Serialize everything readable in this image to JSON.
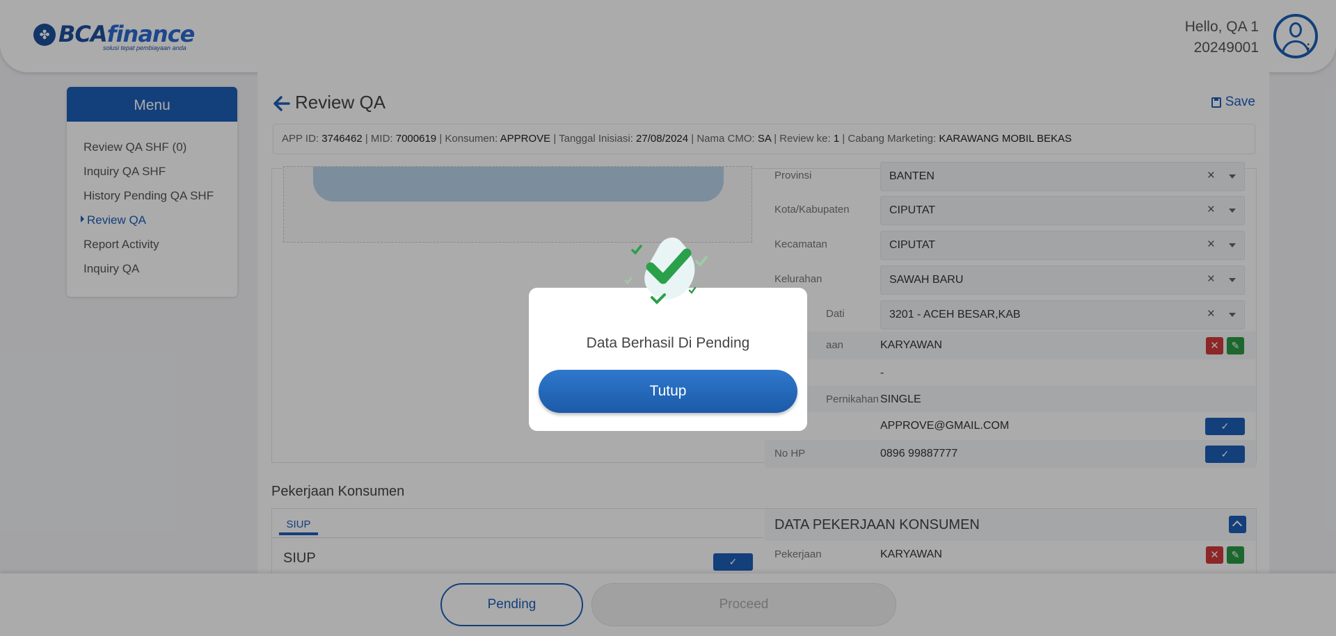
{
  "header": {
    "logo_bca": "BCA",
    "logo_finance": "finance",
    "logo_tagline": "solusi tepat pembiayaan anda",
    "greeting": "Hello, QA 1",
    "user_id": "20249001"
  },
  "sidebar": {
    "title": "Menu",
    "items": [
      {
        "label": "Review QA SHF (0)"
      },
      {
        "label": "Inquiry QA SHF"
      },
      {
        "label": "History Pending QA SHF"
      },
      {
        "label": "Review QA"
      },
      {
        "label": "Report Activity"
      },
      {
        "label": "Inquiry QA"
      }
    ],
    "active_index": 3
  },
  "page": {
    "title": "Review QA",
    "save_label": "Save"
  },
  "infobar": {
    "app_id_label": "APP ID:",
    "app_id": "3746462",
    "mid_label": "MID:",
    "mid": "7000619",
    "konsumen_label": "Konsumen:",
    "konsumen": "APPROVE",
    "tanggal_label": "Tanggal Inisiasi:",
    "tanggal": "27/08/2024",
    "cmo_label": "Nama CMO:",
    "cmo": "SA",
    "review_label": "Review ke:",
    "review": "1",
    "cabang_label": "Cabang Marketing:",
    "cabang": "KARAWANG MOBIL BEKAS"
  },
  "form": {
    "provinsi": {
      "label": "Provinsi",
      "value": "BANTEN"
    },
    "kota": {
      "label": "Kota/Kabupaten",
      "value": "CIPUTAT"
    },
    "kecamatan": {
      "label": "Kecamatan",
      "value": "CIPUTAT"
    },
    "kelurahan": {
      "label": "Kelurahan",
      "value": "SAWAH BARU"
    },
    "dati": {
      "label": "Dati",
      "value": "3201 - ACEH BESAR,KAB"
    },
    "pekerjaan_row": {
      "label": "aan",
      "value": "KARYAWAN"
    },
    "blank_row": {
      "value": "-"
    },
    "pernikahan": {
      "label": "Pernikahan",
      "value": "SINGLE"
    },
    "email": {
      "value": "APPROVE@GMAIL.COM"
    },
    "no_hp": {
      "label": "No HP",
      "value": "0896 99887777"
    }
  },
  "pekerjaan": {
    "section_title": "Pekerjaan Konsumen",
    "tab_label": "SIUP",
    "doc_title": "SIUP",
    "panel_title": "DATA PEKERJAAN KONSUMEN",
    "pekerjaan_label": "Pekerjaan",
    "pekerjaan_value": "KARYAWAN"
  },
  "footer": {
    "pending_label": "Pending",
    "proceed_label": "Proceed"
  },
  "modal": {
    "message": "Data Berhasil Di Pending",
    "button_label": "Tutup"
  },
  "colors": {
    "primary": "#1d5fb8",
    "danger": "#d23a3a",
    "success": "#2a9a44"
  }
}
